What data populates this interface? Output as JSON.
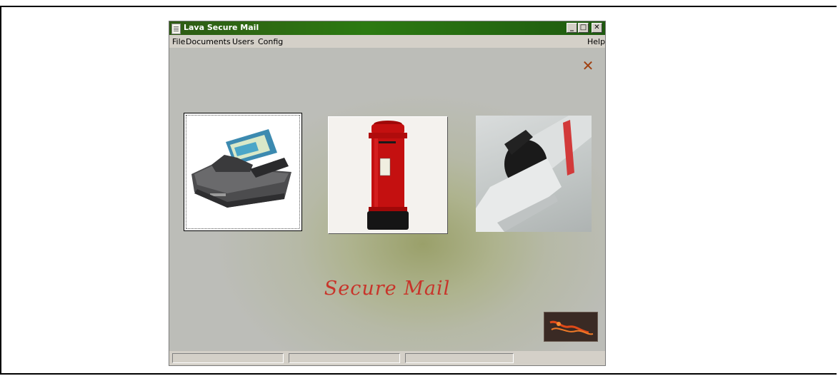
{
  "window": {
    "title": "Lava Secure Mail",
    "buttons": {
      "minimize": "_",
      "maximize": "□",
      "close": "✕"
    }
  },
  "menu": {
    "left": [
      "File",
      "Documents",
      "Users",
      "Config"
    ],
    "right": "Help"
  },
  "content": {
    "close_glyph": "✕",
    "tiles": [
      {
        "name": "scanner",
        "icon": "scanner-image"
      },
      {
        "name": "post-box",
        "icon": "postbox-image"
      },
      {
        "name": "mailbox",
        "icon": "mailbox-image"
      }
    ],
    "brand_text": "Secure Mail",
    "logo": "lava-logo-image"
  },
  "statusbar": {
    "panes": [
      "",
      "",
      ""
    ]
  },
  "colors": {
    "titlebar": "#2c7a12",
    "brand_text": "#c8342a",
    "close_x": "#a04010",
    "postbox_red": "#c41010"
  }
}
